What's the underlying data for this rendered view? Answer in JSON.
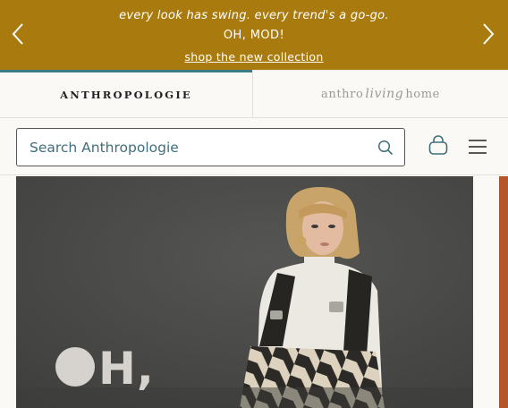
{
  "promo": {
    "line1": "every look has swing. every trend's a go-go.",
    "line2": "OH, MOD!",
    "link": "shop the new collection",
    "bg_color": "#a97b0f"
  },
  "brand_tabs": [
    {
      "label": "ANTHROPOLOGIE",
      "active": true
    },
    {
      "label_pre": "anthro",
      "label_script": "living",
      "label_post": "home",
      "active": false
    }
  ],
  "search": {
    "placeholder": "Search Anthropologie",
    "value": ""
  },
  "icons": {
    "prev": "chevron-left-icon",
    "next": "chevron-right-icon",
    "search": "search-icon",
    "bag": "shopping-bag-icon",
    "menu": "hamburger-menu-icon"
  },
  "hero": {
    "headline": "H,",
    "accent_color": "#3b7a86"
  }
}
